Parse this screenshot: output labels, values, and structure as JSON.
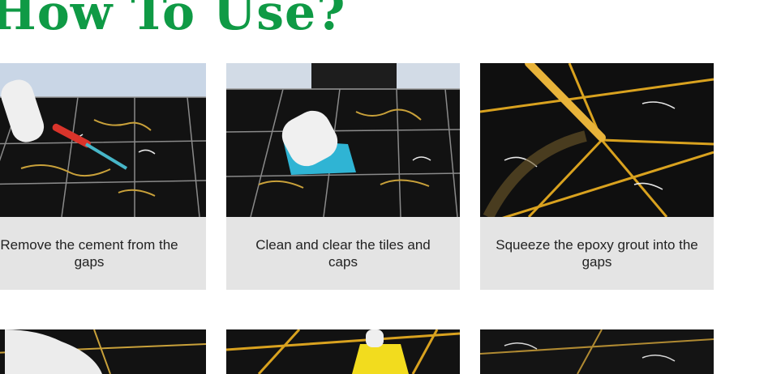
{
  "page": {
    "title": "How To Use?",
    "accent_color": "#0f9a45",
    "caption_bg": "#e4e4e4"
  },
  "steps": [
    {
      "caption": "Remove the cement from the gaps",
      "icon": "scraper-tool-icon"
    },
    {
      "caption": "Clean and clear the tiles and caps",
      "icon": "cleaning-cloth-icon"
    },
    {
      "caption": "Squeeze the epoxy grout into the gaps",
      "icon": "grout-nozzle-icon"
    },
    {
      "caption": "",
      "icon": "gloved-hand-icon"
    },
    {
      "caption": "",
      "icon": "yellow-scraper-icon"
    },
    {
      "caption": "",
      "icon": "marble-tile-icon"
    }
  ]
}
